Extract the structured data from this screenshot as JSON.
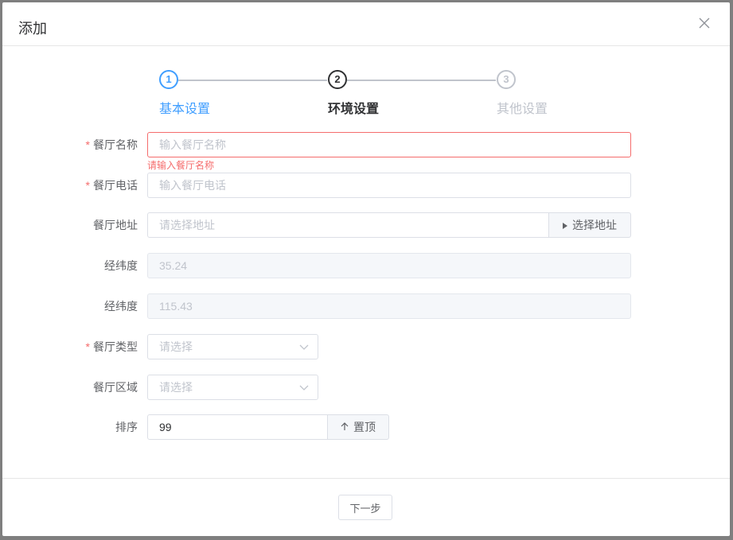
{
  "dialog": {
    "title": "添加",
    "close_icon": "close-icon"
  },
  "steps": [
    {
      "number": "1",
      "title": "基本设置",
      "status": "done"
    },
    {
      "number": "2",
      "title": "环境设置",
      "status": "active"
    },
    {
      "number": "3",
      "title": "其他设置",
      "status": "wait"
    }
  ],
  "form": {
    "name": {
      "label": "餐厅名称",
      "required": "*",
      "placeholder": "输入餐厅名称",
      "error": "请输入餐厅名称"
    },
    "phone": {
      "label": "餐厅电话",
      "required": "*",
      "placeholder": "输入餐厅电话"
    },
    "address": {
      "label": "餐厅地址",
      "placeholder": "请选择地址",
      "button": "选择地址",
      "button_icon": "caret-right-icon"
    },
    "lng": {
      "label": "经纬度",
      "value": "35.24"
    },
    "lat": {
      "label": "经纬度",
      "value": "115.43"
    },
    "type": {
      "label": "餐厅类型",
      "required": "*",
      "placeholder": "请选择"
    },
    "area": {
      "label": "餐厅区域",
      "placeholder": "请选择"
    },
    "sort": {
      "label": "排序",
      "value": "99",
      "button": "置顶",
      "button_icon": "arrow-up-icon"
    }
  },
  "footer": {
    "next_label": "下一步"
  },
  "colors": {
    "primary": "#409eff",
    "error": "#f56c6c",
    "text": "#303133",
    "placeholder": "#c0c4cc"
  }
}
